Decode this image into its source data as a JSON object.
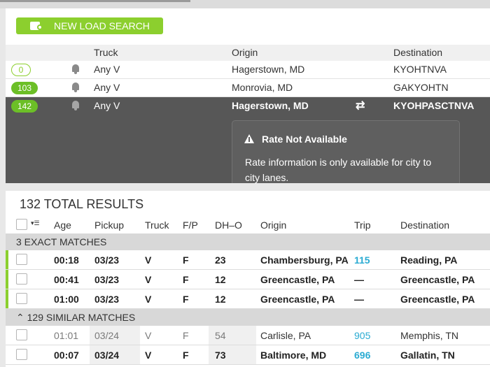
{
  "new_load_search": {
    "label": "NEW LOAD SEARCH"
  },
  "load_list": {
    "headers": {
      "truck": "Truck",
      "origin": "Origin",
      "destination": "Destination"
    },
    "rows": [
      {
        "count": "0",
        "truck": "Any V",
        "origin": "Hagerstown, MD",
        "destination": "KYOHTNVA"
      },
      {
        "count": "103",
        "truck": "Any V",
        "origin": "Monrovia, MD",
        "destination": "GAKYOHTN"
      },
      {
        "count": "142",
        "truck": "Any V",
        "origin": "Hagerstown, MD",
        "destination": "KYOHPASCTNVA",
        "swap_icon": "⇄"
      }
    ]
  },
  "rate_tooltip": {
    "title": "Rate Not Available",
    "body": "Rate information is only available for city to city lanes."
  },
  "results": {
    "total": "132 TOTAL RESULTS",
    "headers": {
      "age": "Age",
      "pickup": "Pickup",
      "truck": "Truck",
      "fp": "F/P",
      "dho": "DH–O",
      "origin": "Origin",
      "trip": "Trip",
      "destination": "Destination"
    },
    "exact_label": "3 EXACT MATCHES",
    "exact": [
      {
        "age": "00:18",
        "pickup": "03/23",
        "truck": "V",
        "fp": "F",
        "dho": "23",
        "origin": "Chambersburg, PA",
        "trip": "115",
        "destination": "Reading, PA"
      },
      {
        "age": "00:41",
        "pickup": "03/23",
        "truck": "V",
        "fp": "F",
        "dho": "12",
        "origin": "Greencastle, PA",
        "trip": "—",
        "destination": "Greencastle, PA"
      },
      {
        "age": "01:00",
        "pickup": "03/23",
        "truck": "V",
        "fp": "F",
        "dho": "12",
        "origin": "Greencastle, PA",
        "trip": "—",
        "destination": "Greencastle, PA"
      }
    ],
    "similar_label": "129 SIMILAR MATCHES",
    "similar": [
      {
        "age": "01:01",
        "pickup": "03/24",
        "truck": "V",
        "fp": "F",
        "dho": "54",
        "origin": "Carlisle, PA",
        "trip": "905",
        "destination": "Memphis, TN"
      },
      {
        "age": "00:07",
        "pickup": "03/24",
        "truck": "V",
        "fp": "F",
        "dho": "73",
        "origin": "Baltimore, MD",
        "trip": "696",
        "destination": "Gallatin, TN"
      }
    ]
  },
  "colors": {
    "accent_green": "#8ccf2e",
    "trip_link": "#2aabd2",
    "selected_row": "#575757"
  }
}
